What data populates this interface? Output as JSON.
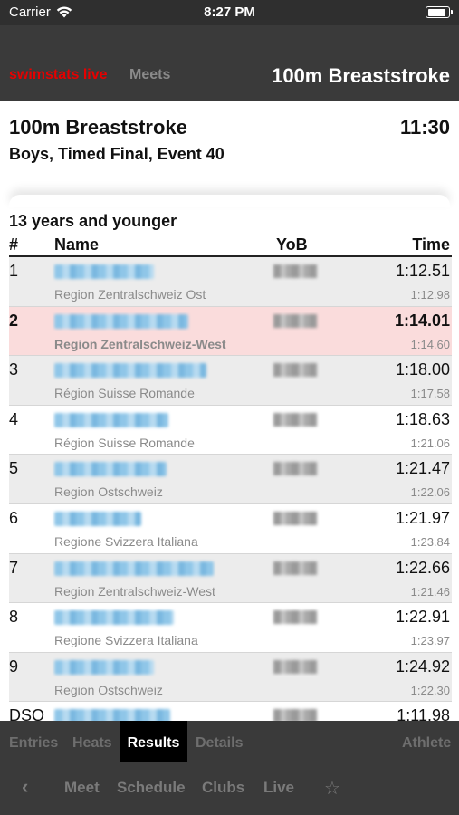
{
  "status_bar": {
    "carrier": "Carrier",
    "time": "8:27 PM"
  },
  "nav": {
    "brand": "swimstats live",
    "meets": "Meets",
    "title": "100m Breaststroke"
  },
  "event": {
    "title": "100m Breaststroke",
    "time": "11:30",
    "subtitle": "Boys, Timed Final, Event 40"
  },
  "group": {
    "title": "13 years and younger"
  },
  "columns": {
    "rank": "#",
    "name": "Name",
    "yob": "YoB",
    "time": "Time"
  },
  "rows": [
    {
      "rank": "1",
      "time": "1:12.51",
      "region": "Region Zentralschweiz Ost",
      "seed": "1:12.98"
    },
    {
      "rank": "2",
      "time": "1:14.01",
      "region": "Region Zentralschweiz-West",
      "seed": "1:14.60"
    },
    {
      "rank": "3",
      "time": "1:18.00",
      "region": "Région Suisse Romande",
      "seed": "1:17.58"
    },
    {
      "rank": "4",
      "time": "1:18.63",
      "region": "Région Suisse Romande",
      "seed": "1:21.06"
    },
    {
      "rank": "5",
      "time": "1:21.47",
      "region": "Region Ostschweiz",
      "seed": "1:22.06"
    },
    {
      "rank": "6",
      "time": "1:21.97",
      "region": "Regione Svizzera Italiana",
      "seed": "1:23.84"
    },
    {
      "rank": "7",
      "time": "1:22.66",
      "region": "Region Zentralschweiz-West",
      "seed": "1:21.46"
    },
    {
      "rank": "8",
      "time": "1:22.91",
      "region": "Regione Svizzera Italiana",
      "seed": "1:23.97"
    },
    {
      "rank": "9",
      "time": "1:24.92",
      "region": "Region Ostschweiz",
      "seed": "1:22.30"
    },
    {
      "rank": "DSQ",
      "time": "1:11.98",
      "region": "",
      "seed": ""
    }
  ],
  "sub_tabs": {
    "entries": "Entries",
    "heats": "Heats",
    "results": "Results",
    "details": "Details",
    "athlete": "Athlete"
  },
  "bottom_bar": {
    "back": "‹",
    "meet": "Meet",
    "schedule": "Schedule",
    "clubs": "Clubs",
    "live": "Live",
    "star": "☆"
  },
  "colors": {
    "brand": "#e60000",
    "highlight": "#fadcdc",
    "bar": "#3a3a3a"
  }
}
